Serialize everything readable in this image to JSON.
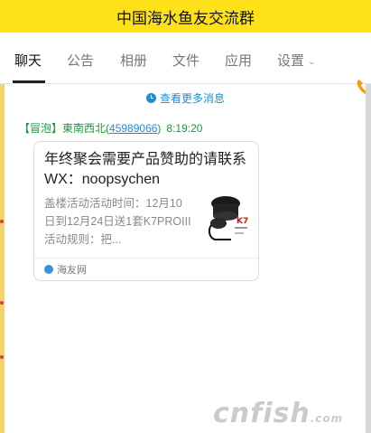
{
  "window": {
    "title": "中国海水鱼友交流群"
  },
  "tabs": [
    {
      "label": "聊天",
      "active": true
    },
    {
      "label": "公告"
    },
    {
      "label": "相册"
    },
    {
      "label": "文件"
    },
    {
      "label": "应用"
    },
    {
      "label": "设置"
    }
  ],
  "chat": {
    "more_messages": "查看更多消息",
    "message": {
      "badge": "【冒泡】",
      "sender_name": "東南西北",
      "sender_id": "45989066",
      "time": "8:19:20",
      "card": {
        "title": "年终聚会需要产品赞助的请联系WX：noopsychen",
        "description": "盖楼活动活动时间：12月10日到12月24日送1套K7PROIII活动规则：把...",
        "source": "海友网"
      }
    }
  },
  "watermark": {
    "text": "cnfish",
    "suffix": ".com"
  },
  "colors": {
    "titlebar": "#ffe11a",
    "link": "#1a8fd6",
    "sender": "#1b9a3a"
  }
}
